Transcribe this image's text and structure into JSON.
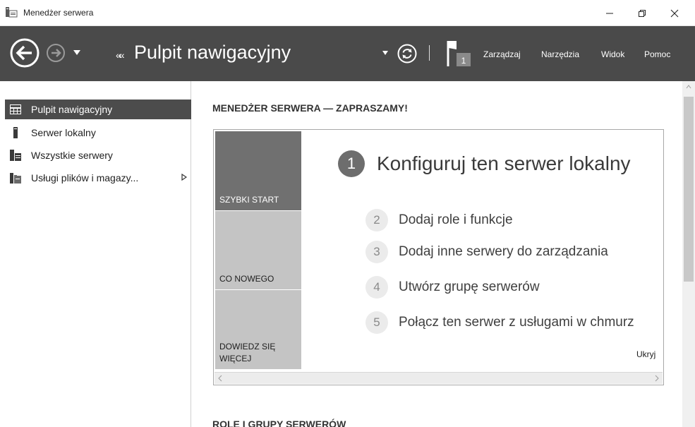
{
  "window": {
    "title": "Menedżer serwera",
    "minimize_icon": "minimize-icon",
    "maximize_icon": "restore-icon",
    "close_icon": "close-icon"
  },
  "header": {
    "breadcrumb_chevron": "««",
    "breadcrumb_title": "Pulpit nawigacyjny",
    "notification_count": "1",
    "menu": [
      "Zarządzaj",
      "Narzędzia",
      "Widok",
      "Pomoc"
    ],
    "colors": {
      "background": "#4a4a4a",
      "text": "#ffffff"
    }
  },
  "sidebar": {
    "items": [
      {
        "label": "Pulpit nawigacyjny",
        "icon": "dashboard-icon",
        "active": true
      },
      {
        "label": "Serwer lokalny",
        "icon": "server-icon",
        "active": false
      },
      {
        "label": "Wszystkie serwery",
        "icon": "servers-icon",
        "active": false
      },
      {
        "label": "Usługi plików i magazy...",
        "icon": "file-storage-icon",
        "active": false,
        "has_submenu": true
      }
    ]
  },
  "main": {
    "welcome_title": "MENEDŻER SERWERA — ZAPRASZAMY!",
    "tiles": [
      "SZYBKI START",
      "CO NOWEGO",
      "DOWIEDZ SIĘ\nWIĘCEJ"
    ],
    "primary_step": {
      "num": "1",
      "text": "Konfiguruj ten serwer lokalny"
    },
    "steps": [
      {
        "num": "2",
        "text": "Dodaj role i funkcje"
      },
      {
        "num": "3",
        "text": "Dodaj inne serwery do zarządzania"
      },
      {
        "num": "4",
        "text": "Utwórz grupę serwerów"
      },
      {
        "num": "5",
        "text": "Połącz ten serwer z usługami w chmurz"
      }
    ],
    "hide_label": "Ukryj",
    "roles_title": "ROLE I GRUPY SERWERÓW"
  }
}
